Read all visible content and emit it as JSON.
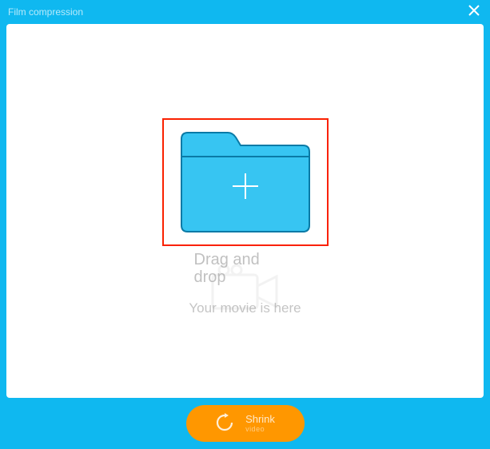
{
  "colors": {
    "bg": "#0fb8f0",
    "accent": "#ff9700",
    "dropzone_border": "#fa2100",
    "folder_fill": "#37c5f2",
    "folder_stroke": "#0a7aa6"
  },
  "titlebar": {
    "title": "Film compression"
  },
  "dropzone": {
    "line1": "Drag and",
    "line2": "drop",
    "subtitle": "Your movie is here"
  },
  "action": {
    "label": "Shrink",
    "sublabel": "video"
  }
}
